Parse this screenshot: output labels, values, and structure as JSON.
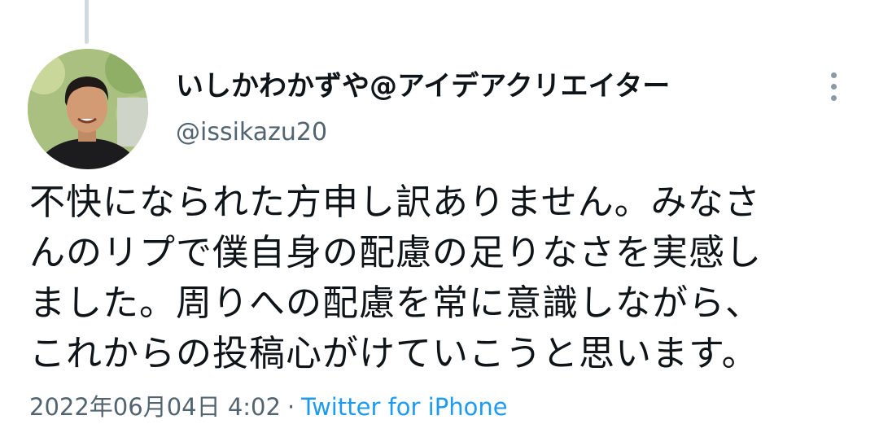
{
  "tweet": {
    "author": {
      "display_name": "いしかわかずや@アイデアクリエイター",
      "handle": "@issikazu20"
    },
    "text_lines": [
      "不快になられた方申し訳ありません。みなさ",
      "んのリプで僕自身の配慮の足りなさを実感し",
      "ました。周りへの配慮を常に意識しながら、",
      "これからの投稿心がけていこうと思います。"
    ],
    "timestamp": "2022年06月04日 4:02",
    "separator": "·",
    "source": "Twitter for iPhone"
  },
  "icons": {
    "more": "more-vertical-icon",
    "thread": "thread-connector-line"
  },
  "colors": {
    "text": "#0f1419",
    "secondary": "#536471",
    "link": "#1d9bf0",
    "thread_line": "#cfd9de"
  }
}
